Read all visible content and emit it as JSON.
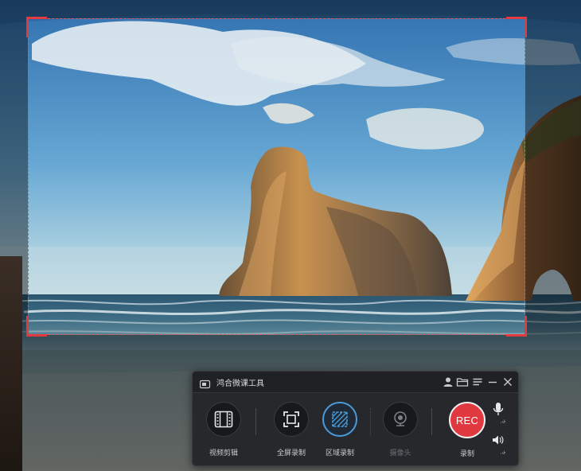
{
  "app": {
    "title": "鸿合微课工具"
  },
  "tools": [
    {
      "label": "视频剪辑",
      "icon": "video-edit-icon",
      "state": "normal"
    },
    {
      "label": "全屏录制",
      "icon": "fullscreen-icon",
      "state": "normal"
    },
    {
      "label": "区域录制",
      "icon": "area-record-icon",
      "state": "active"
    },
    {
      "label": "摄像头",
      "icon": "webcam-icon",
      "state": "disabled"
    }
  ],
  "record": {
    "button_label": "REC",
    "label": "录制"
  },
  "colors": {
    "accent_red": "#e0393f",
    "active_blue": "#4a9bd8",
    "panel_bg": "#26282c"
  },
  "icons": {
    "user": "user-icon",
    "folder": "folder-icon",
    "menu": "menu-icon",
    "minimize": "minimize-icon",
    "close": "close-icon",
    "mic": "microphone-icon",
    "speaker": "speaker-icon"
  }
}
